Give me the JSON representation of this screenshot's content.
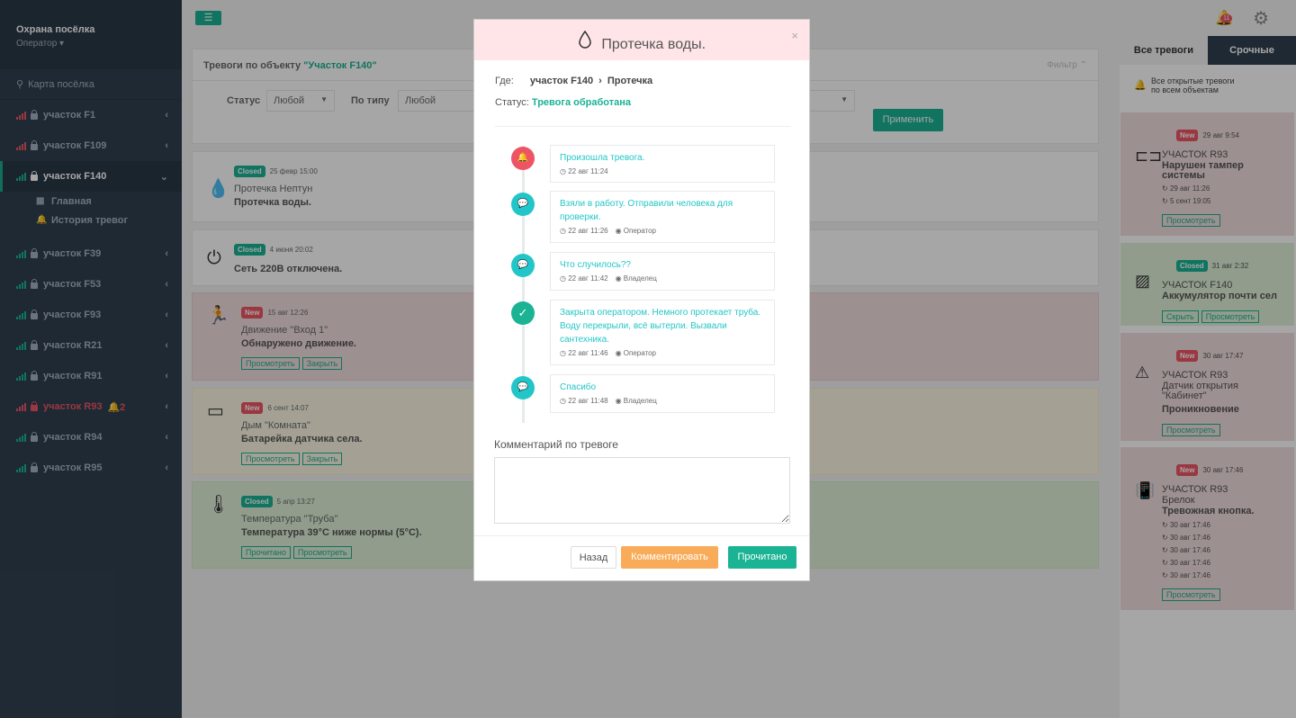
{
  "sidebar": {
    "brand": "Охрана посёлка",
    "role": "Оператор",
    "map": "Карта посёлка",
    "items": [
      {
        "label": "участок F1",
        "signal": "red"
      },
      {
        "label": "участок F109",
        "signal": "red"
      },
      {
        "label": "участок F140",
        "signal": "green",
        "active": true
      },
      {
        "label": "участок F39",
        "signal": "green"
      },
      {
        "label": "участок F53",
        "signal": "green"
      },
      {
        "label": "участок F93",
        "signal": "green"
      },
      {
        "label": "участок R21",
        "signal": "green"
      },
      {
        "label": "участок R91",
        "signal": "green"
      },
      {
        "label": "участок R93",
        "signal": "red",
        "alarm": true,
        "alarm_count": "2"
      },
      {
        "label": "участок R94",
        "signal": "green"
      },
      {
        "label": "участок R95",
        "signal": "green"
      }
    ],
    "sub": {
      "main": "Главная",
      "history": "История тревог"
    }
  },
  "topbar": {
    "notifications": "11"
  },
  "panel": {
    "title_prefix": "Тревоги по объекту ",
    "title_object": "\"Участок F140\"",
    "filter": "Фильтр",
    "status_label": "Статус",
    "status_value": "Любой",
    "type_label": "По типу",
    "type_value": "Любой",
    "apply": "Применить"
  },
  "cards": [
    {
      "tag": "Closed",
      "time": "25 февр 15:00",
      "line1": "Протечка Нептун",
      "line2": "Протечка воды.",
      "buttons": []
    },
    {
      "tag": "Closed",
      "time": "4 июня 20:02",
      "line1": "",
      "line2": "Сеть 220В отключена.",
      "buttons": []
    },
    {
      "tag": "New",
      "time": "15 авг 12:26",
      "line1": "Движение \"Вход 1\"",
      "line2": "Обнаружено движение.",
      "buttons": [
        "Просмотреть",
        "Закрыть"
      ]
    },
    {
      "tag": "New",
      "time": "6 сент 14:07",
      "line1": "Дым \"Комната\"",
      "line2": "Батарейка датчика села.",
      "buttons": [
        "Просмотреть",
        "Закрыть"
      ]
    },
    {
      "tag": "Closed",
      "time": "5 апр 13:27",
      "line1": "Температура \"Труба\"",
      "line2": "Температура 39°С ниже нормы (5°С).",
      "buttons": [
        "Прочитано",
        "Просмотреть"
      ]
    }
  ],
  "right_panel": {
    "tab_all": "Все тревоги",
    "tab_urgent": "Срочные",
    "all_open_line1": "Все открытые тревоги",
    "all_open_line2": "по всем объектам",
    "cards": [
      {
        "tag": "New",
        "time": "29 авг 9:54",
        "object": "УЧАСТОК R93",
        "line1": "Нарушен тампер",
        "line2": "системы",
        "times": [
          "29 авг 11:26",
          "5 сент 19:05"
        ],
        "buttons": [
          "Просмотреть"
        ]
      },
      {
        "tag": "Closed",
        "time": "31 авг 2:32",
        "object": "УЧАСТОК F140",
        "line1": "Аккумулятор почти сел",
        "line2": "",
        "times": [],
        "buttons": [
          "Скрыть",
          "Просмотреть"
        ]
      },
      {
        "tag": "New",
        "time": "30 авг 17:47",
        "object": "УЧАСТОК R93",
        "line1": "Датчик открытия",
        "line2": "\"Кабинет\"",
        "line3": "Проникновение",
        "times": [],
        "buttons": [
          "Просмотреть"
        ]
      },
      {
        "tag": "New",
        "time": "30 авг 17:46",
        "object": "УЧАСТОК R93",
        "line1": "Брелок",
        "line2": "Тревожная кнопка.",
        "times": [
          "30 авг 17:46",
          "30 авг 17:46",
          "30 авг 17:46",
          "30 авг 17:46",
          "30 авг 17:46"
        ],
        "buttons": [
          "Просмотреть"
        ]
      }
    ]
  },
  "modal": {
    "title": "Протечка воды.",
    "where_label": "Где:",
    "where_object": "участок F140",
    "where_sensor": "Протечка",
    "status_label": "Статус:",
    "status_value": "Тревога обработана",
    "timeline": [
      {
        "icon": "bell",
        "color": "#ed5565",
        "text": "Произошла тревога.",
        "time": "22 авг 11:24",
        "who": ""
      },
      {
        "icon": "comment",
        "color": "#23c6c8",
        "text": "Взяли в работу. Отправили человека для проверки.",
        "time": "22 авг 11:26",
        "who": "Оператор"
      },
      {
        "icon": "comment",
        "color": "#23c6c8",
        "text": "Что случилось??",
        "time": "22 авг 11:42",
        "who": "Владелец"
      },
      {
        "icon": "check",
        "color": "#1ab394",
        "text": "Закрыта оператором. Немного протекает труба.  Воду перекрыли, всё вытерли.  Вызвали  сантехника.",
        "time": "22 авг 11:46",
        "who": "Оператор"
      },
      {
        "icon": "comment",
        "color": "#23c6c8",
        "text": "Спасибо",
        "time": "22 авг 11:48",
        "who": "Владелец"
      }
    ],
    "comment_label": "Комментарий по тревоге",
    "btn_back": "Назад",
    "btn_comment": "Комментировать",
    "btn_read": "Прочитано"
  }
}
